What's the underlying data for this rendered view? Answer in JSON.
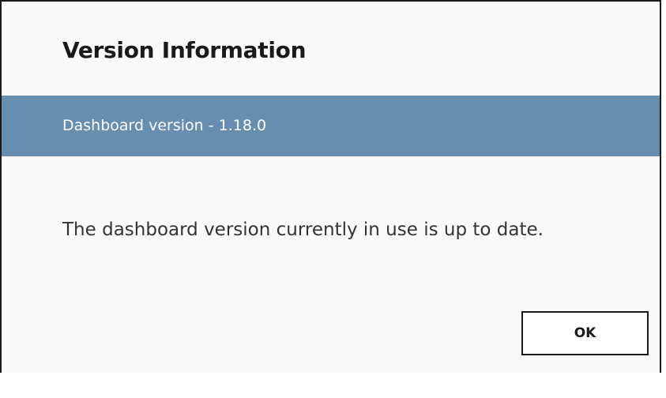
{
  "dialog": {
    "title": "Version Information",
    "version_label": "Dashboard version - 1.18.0",
    "message": "The dashboard version currently in use is up to date.",
    "ok_label": "OK"
  },
  "colors": {
    "version_bar": "#678eae",
    "background": "#fafafa",
    "border": "#1a1a1a"
  }
}
